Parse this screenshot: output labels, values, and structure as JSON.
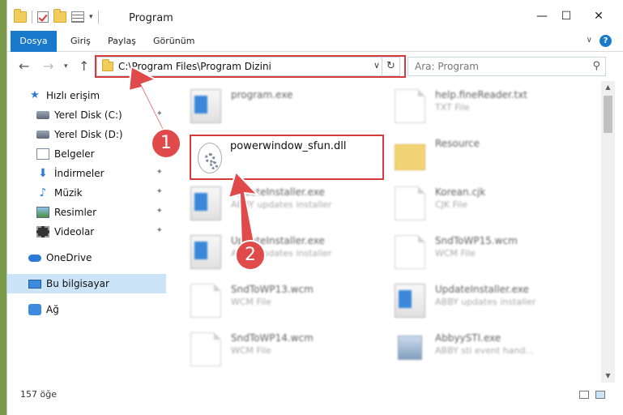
{
  "window": {
    "title": "Program",
    "minimize": "—",
    "maximize": "☐",
    "close": "✕"
  },
  "ribbon": {
    "tabs": [
      "Dosya",
      "Giriş",
      "Paylaş",
      "Görünüm"
    ],
    "help": "?"
  },
  "address": {
    "path": "C:\\Program Files\\Program Dizini",
    "search_placeholder": "Ara: Program"
  },
  "sidebar": {
    "items": [
      {
        "label": "Hızlı erişim",
        "icon": "star-icon"
      },
      {
        "label": "Yerel Disk (C:)",
        "icon": "drive-icon"
      },
      {
        "label": "Yerel Disk (D:)",
        "icon": "drive-icon"
      },
      {
        "label": "Belgeler",
        "icon": "documents-icon"
      },
      {
        "label": "İndirmeler",
        "icon": "download-icon"
      },
      {
        "label": "Müzik",
        "icon": "music-icon"
      },
      {
        "label": "Resimler",
        "icon": "pictures-icon"
      },
      {
        "label": "Videolar",
        "icon": "videos-icon"
      },
      {
        "label": "OneDrive",
        "icon": "cloud-icon"
      },
      {
        "label": "Bu bilgisayar",
        "icon": "computer-icon"
      },
      {
        "label": "Ağ",
        "icon": "network-icon"
      }
    ]
  },
  "files": [
    {
      "name": "program.exe",
      "type": "",
      "icon": "app-icon"
    },
    {
      "name": "help.fineReader.txt",
      "type": "TXT File",
      "icon": "document-icon"
    },
    {
      "name": "Resource",
      "type": "",
      "icon": "folder-icon"
    },
    {
      "name": "UpdateInstaller.exe",
      "type": "ABBY updates installer",
      "icon": "app-icon"
    },
    {
      "name": "Korean.cjk",
      "type": "CJK File",
      "icon": "document-icon"
    },
    {
      "name": "UpdateInstaller.exe",
      "type": "ABBY updates installer",
      "icon": "app-icon"
    },
    {
      "name": "SndToWP15.wcm",
      "type": "WCM File",
      "icon": "document-icon"
    },
    {
      "name": "SndToWP13.wcm",
      "type": "WCM File",
      "icon": "document-icon"
    },
    {
      "name": "UpdateInstaller.exe",
      "type": "ABBY updates installer",
      "icon": "app-icon"
    },
    {
      "name": "SndToWP14.wcm",
      "type": "WCM File",
      "icon": "document-icon"
    },
    {
      "name": "AbbyySTI.exe",
      "type": "ABBY sti event hand...",
      "icon": "app-icon"
    }
  ],
  "highlighted_file": {
    "name": "powerwindow_sfun.dll",
    "icon": "dll-gear-icon"
  },
  "status": {
    "count": "157 öğe"
  },
  "callouts": {
    "one": "1",
    "two": "2"
  },
  "colors": {
    "accent": "#1979ca",
    "callout": "#e04a4a",
    "selection": "#cce4f7"
  }
}
